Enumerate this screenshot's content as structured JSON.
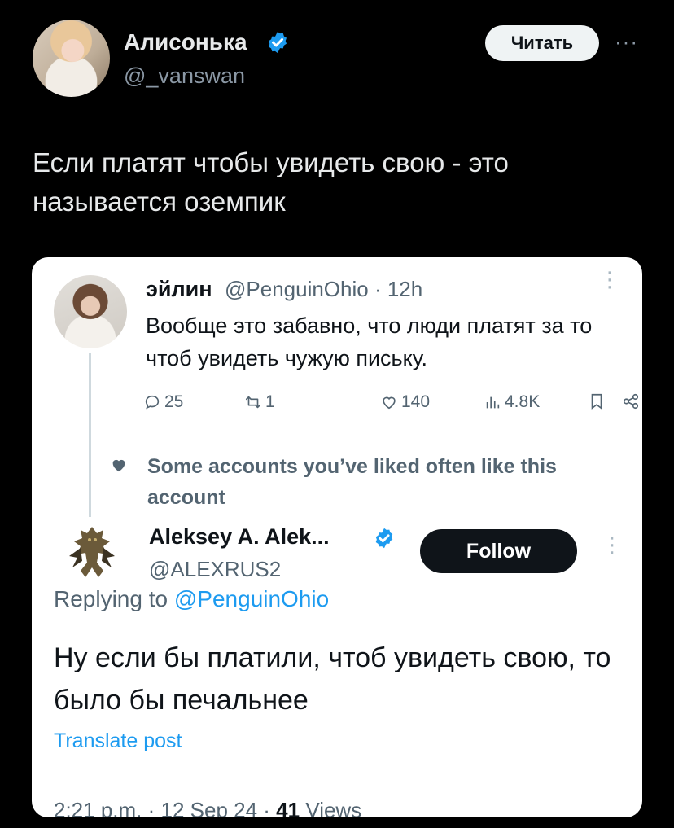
{
  "post": {
    "author_name": "Алисонька",
    "author_handle": "@_vanswan",
    "read_label": "Читать",
    "more_label": "···",
    "text": "Если платят чтобы увидеть свою - это называется оземпик"
  },
  "quoted": {
    "original": {
      "name": "эйлин",
      "handle_time": "@PenguinOhio · 12h",
      "text": "Вообще это забавно, что люди платят за то чтоб увидеть чужую письку.",
      "metrics": {
        "replies": "25",
        "reposts": "1",
        "likes": "140",
        "views": "4.8K"
      }
    },
    "liked_notice": "Some accounts you’ve liked often like this account",
    "reply": {
      "name": "Aleksey A. Alek...",
      "handle": "@ALEXRUS2",
      "follow_label": "Follow",
      "replying_prefix": "Replying to",
      "replying_mention": "@PenguinOhio",
      "text": "Ну если бы платили, чтоб увидеть свою, то было бы печальнее",
      "translate_label": "Translate post",
      "timestamp": "2:21 p.m. · 12 Sep 24 ·",
      "views_count": "41",
      "views_label": "Views"
    }
  },
  "colors": {
    "background": "#000000",
    "card": "#ffffff",
    "accent": "#1d9bf0",
    "muted": "#536471"
  }
}
